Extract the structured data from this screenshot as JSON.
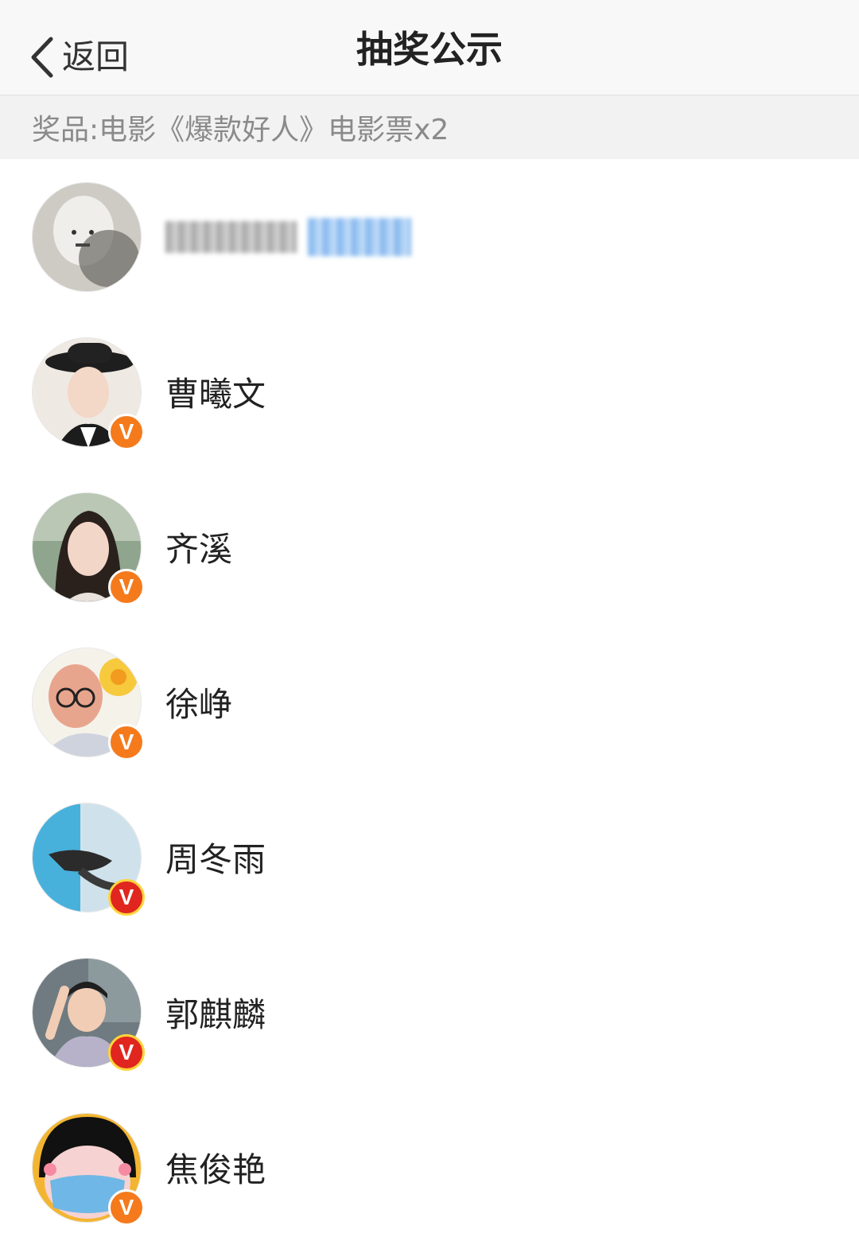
{
  "navbar": {
    "back_label": "返回",
    "title": "抽奖公示"
  },
  "prize": {
    "text": "奖品:电影《爆款好人》电影票x2"
  },
  "winners": [
    {
      "name": "",
      "name_redacted": true,
      "verified": false,
      "badge": "",
      "avatar": "redacted-avatar"
    },
    {
      "name": "曹曦文",
      "verified": true,
      "badge": "V",
      "badge_color": "#f57a1c",
      "avatar": "woman-in-hat-avatar"
    },
    {
      "name": "齐溪",
      "verified": true,
      "badge": "V",
      "badge_color": "#f57a1c",
      "avatar": "woman-portrait-avatar"
    },
    {
      "name": "徐峥",
      "verified": true,
      "badge": "V",
      "badge_color": "#f57a1c",
      "avatar": "cartoon-man-avatar"
    },
    {
      "name": "周冬雨",
      "verified": true,
      "badge": "V",
      "badge_color": "#e0261e",
      "avatar": "underwater-avatar"
    },
    {
      "name": "郭麒麟",
      "verified": true,
      "badge": "V",
      "badge_color": "#e0261e",
      "avatar": "smiling-man-avatar"
    },
    {
      "name": "焦俊艳",
      "verified": true,
      "badge": "V",
      "badge_color": "#f57a1c",
      "avatar": "cartoon-girl-mask-avatar"
    }
  ]
}
